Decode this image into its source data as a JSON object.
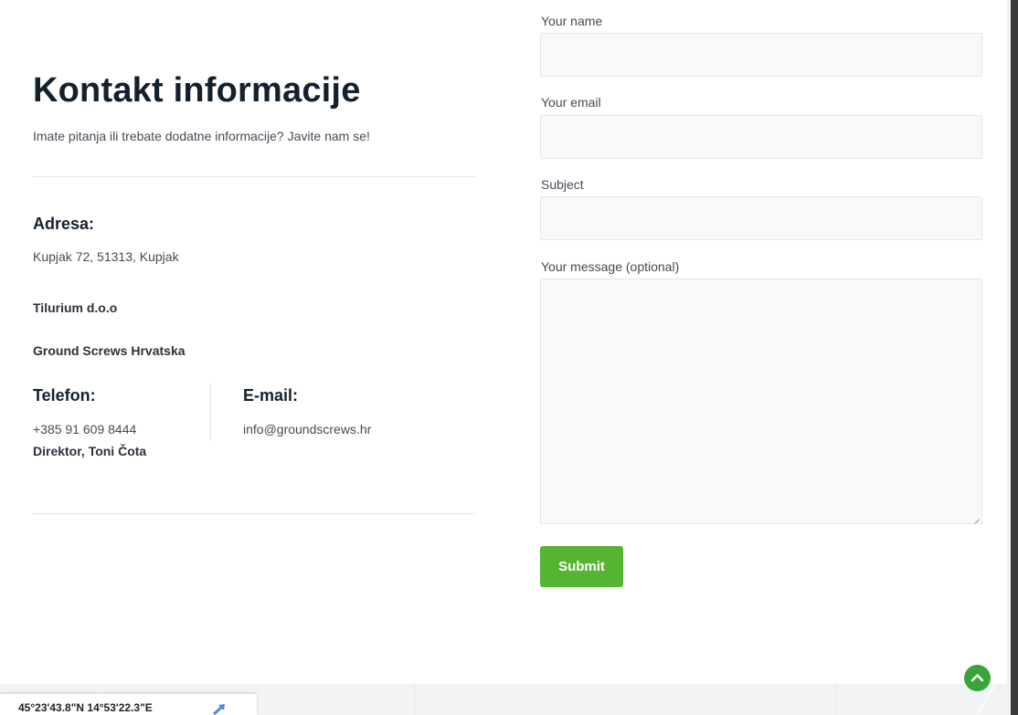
{
  "contact": {
    "title": "Kontakt informacije",
    "subtitle": "Imate pitanja ili trebate dodatne informacije? Javite nam se!",
    "address_heading": "Adresa:",
    "address": "Kupjak 72, 51313, Kupjak",
    "company": "Tilurium d.o.o",
    "brand": "Ground Screws Hrvatska",
    "phone_heading": "Telefon:",
    "phone": "+385 91 609 8444",
    "director": "Direktor, Toni Čota",
    "email_heading": "E-mail:",
    "email": "info@groundscrews.hr"
  },
  "form": {
    "name_label": "Your name",
    "email_label": "Your email",
    "subject_label": "Subject",
    "message_label": "Your message (optional)",
    "name_value": "",
    "email_value": "",
    "subject_value": "",
    "message_value": "",
    "submit_label": "Submit"
  },
  "map": {
    "coordinates": "45°23'43.8\"N 14°53'22.3\"E",
    "directions_icon": "directions-icon"
  },
  "scroll_top_icon": "chevron-up-icon",
  "colors": {
    "accent_green": "#55b432",
    "scroll_green": "#3aa33a",
    "heading": "#14202e",
    "text": "#444b55",
    "field_bg": "#f8f9fa"
  }
}
